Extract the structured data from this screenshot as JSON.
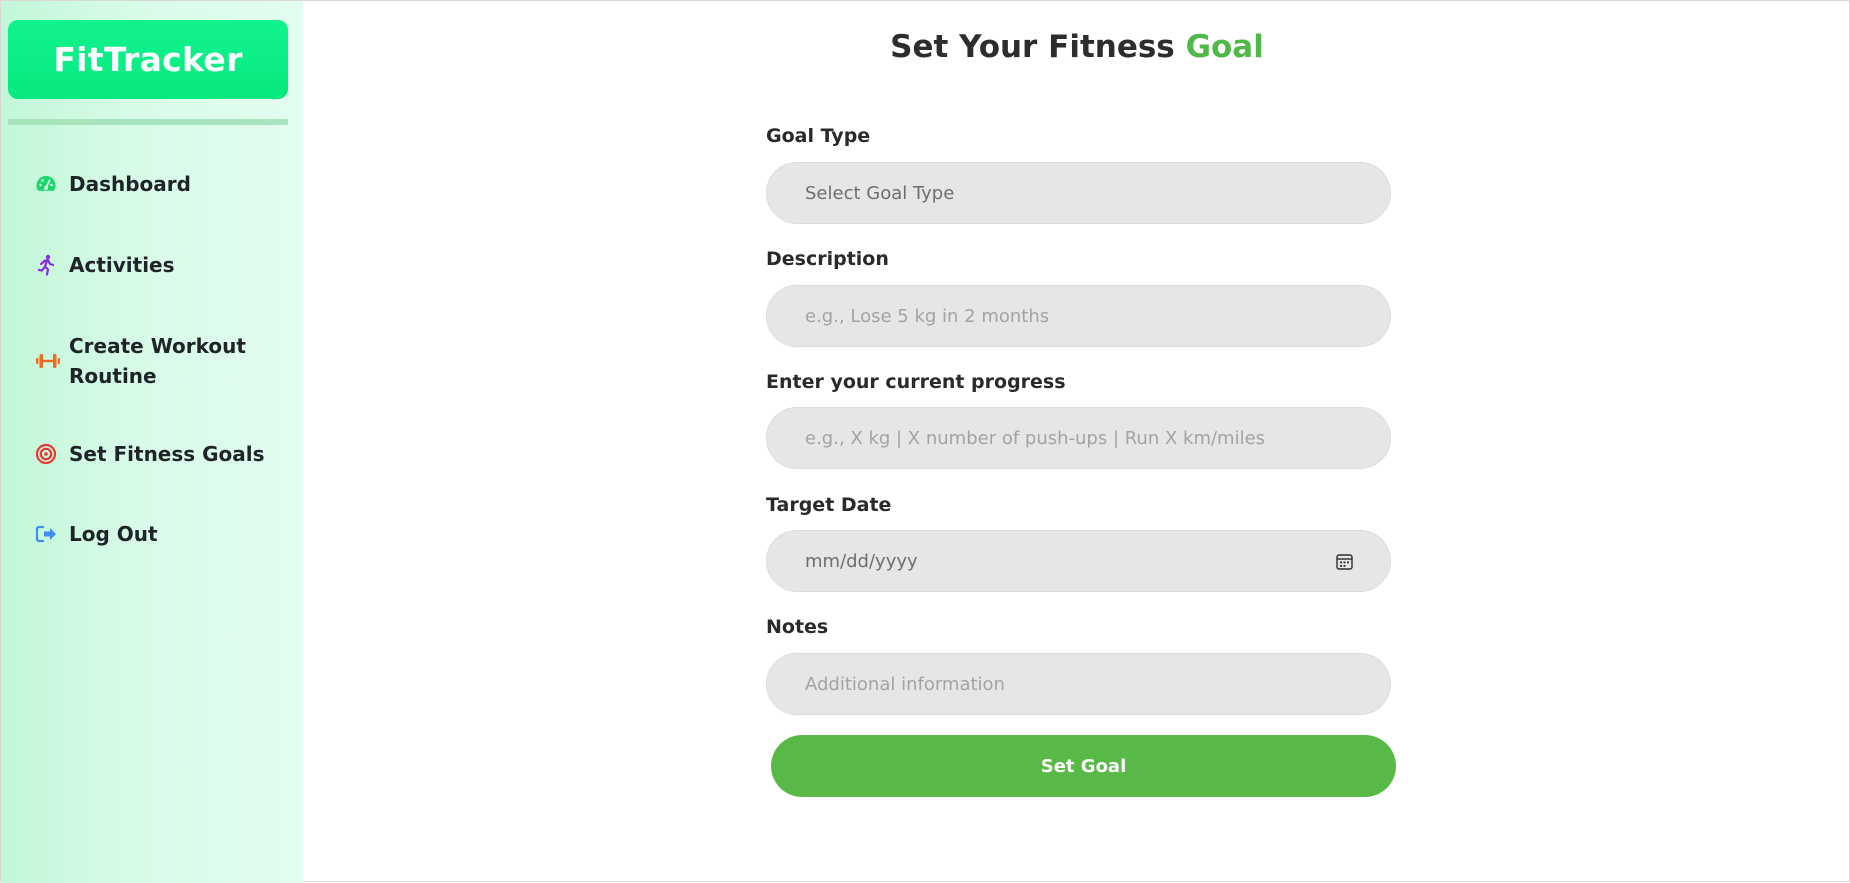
{
  "brand": {
    "name": "FitTracker"
  },
  "sidebar": {
    "items": [
      {
        "label": "Dashboard",
        "icon": "gauge-icon",
        "color": "#19d86b"
      },
      {
        "label": "Activities",
        "icon": "running-person-icon",
        "color": "#8a2be2"
      },
      {
        "label": "Create Workout Routine",
        "icon": "dumbbell-icon",
        "color": "#f26d1f"
      },
      {
        "label": "Set Fitness Goals",
        "icon": "target-icon",
        "color": "#e53935"
      },
      {
        "label": "Log Out",
        "icon": "logout-icon",
        "color": "#3d8ef0"
      }
    ]
  },
  "main": {
    "title_prefix": "Set Your Fitness ",
    "title_accent": "Goal",
    "accent_color": "#4fb848",
    "form": {
      "goal_type": {
        "label": "Goal Type",
        "value": "Select Goal Type"
      },
      "description": {
        "label": "Description",
        "placeholder": "e.g., Lose 5 kg in 2 months"
      },
      "progress": {
        "label": "Enter your current progress",
        "placeholder": "e.g., X kg | X number of push-ups | Run X km/miles"
      },
      "target_date": {
        "label": "Target Date",
        "placeholder": "mm/dd/yyyy"
      },
      "notes": {
        "label": "Notes",
        "placeholder": "Additional information"
      },
      "submit_label": "Set Goal"
    }
  }
}
